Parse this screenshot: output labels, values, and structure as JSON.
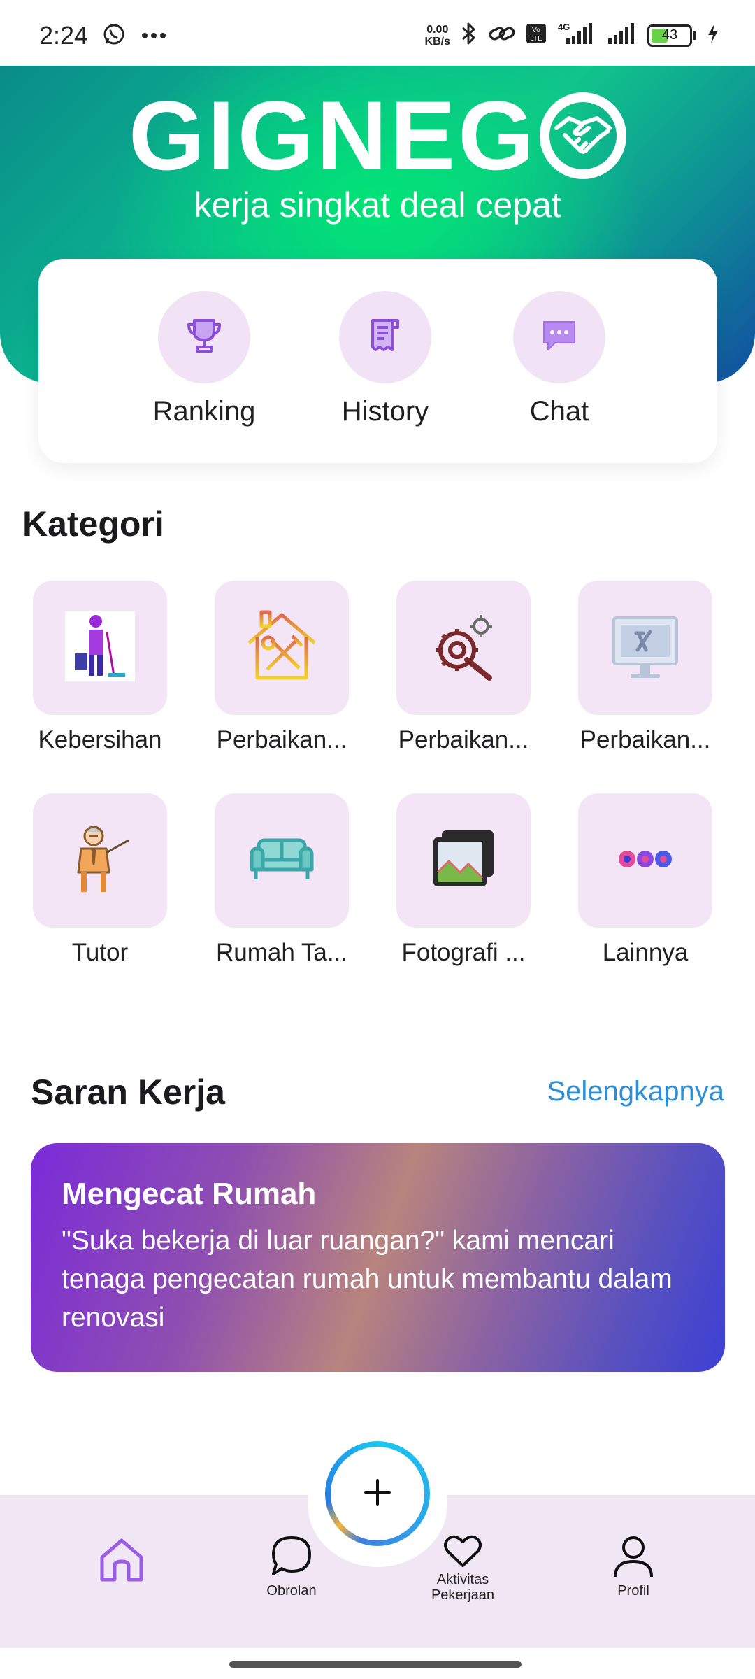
{
  "status_bar": {
    "time": "2:24",
    "net_speed_value": "0.00",
    "net_speed_unit": "KB/s",
    "battery": "43",
    "battery_level": 0.43
  },
  "header": {
    "brand_left": "GIGNEG",
    "tagline": "kerja singkat deal cepat"
  },
  "quick_actions": [
    {
      "label": "Ranking",
      "icon": "trophy-icon"
    },
    {
      "label": "History",
      "icon": "receipt-icon"
    },
    {
      "label": "Chat",
      "icon": "chat-bubble-icon"
    }
  ],
  "categories": {
    "title": "Kategori",
    "items": [
      {
        "label": "Kebersihan",
        "icon": "cleaner-icon"
      },
      {
        "label": "Perbaikan...",
        "icon": "house-tools-icon"
      },
      {
        "label": "Perbaikan...",
        "icon": "gear-wrench-icon"
      },
      {
        "label": "Perbaikan...",
        "icon": "computer-repair-icon"
      },
      {
        "label": "Tutor",
        "icon": "teacher-icon"
      },
      {
        "label": "Rumah Ta...",
        "icon": "sofa-icon"
      },
      {
        "label": "Fotografi ...",
        "icon": "photo-gallery-icon"
      },
      {
        "label": "Lainnya",
        "icon": "more-dots-icon"
      }
    ]
  },
  "suggestions": {
    "title": "Saran Kerja",
    "see_more": "Selengkapnya",
    "card": {
      "title": "Mengecat Rumah",
      "description": "\"Suka bekerja di luar ruangan?\" kami mencari tenaga pengecatan rumah untuk membantu dalam renovasi"
    }
  },
  "bottom_nav": {
    "items": [
      {
        "label": "",
        "icon": "home-icon"
      },
      {
        "label": "Obrolan",
        "icon": "chat-icon"
      },
      {
        "label": "Aktivitas Pekerjaan",
        "icon": "heart-icon"
      },
      {
        "label": "Profil",
        "icon": "person-icon"
      }
    ],
    "fab_icon": "plus-icon"
  },
  "colors": {
    "accent_blue": "#2e8fd6",
    "header_green": "#00e575",
    "tile_bg": "#f3e5f5",
    "nav_bg": "#f0e6f4",
    "home_active": "#9b5de5"
  }
}
